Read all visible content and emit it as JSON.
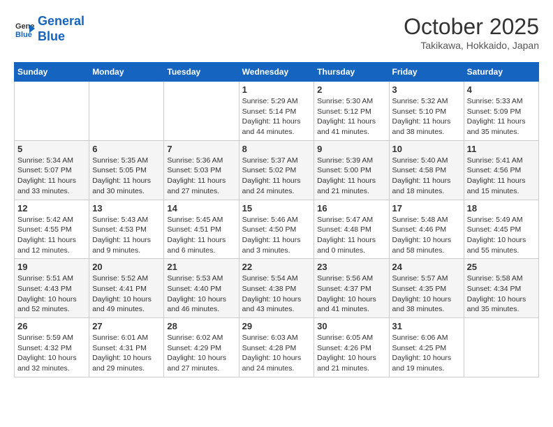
{
  "header": {
    "logo_line1": "General",
    "logo_line2": "Blue",
    "month": "October 2025",
    "location": "Takikawa, Hokkaido, Japan"
  },
  "weekdays": [
    "Sunday",
    "Monday",
    "Tuesday",
    "Wednesday",
    "Thursday",
    "Friday",
    "Saturday"
  ],
  "weeks": [
    [
      {
        "day": "",
        "info": ""
      },
      {
        "day": "",
        "info": ""
      },
      {
        "day": "",
        "info": ""
      },
      {
        "day": "1",
        "info": "Sunrise: 5:29 AM\nSunset: 5:14 PM\nDaylight: 11 hours and 44 minutes."
      },
      {
        "day": "2",
        "info": "Sunrise: 5:30 AM\nSunset: 5:12 PM\nDaylight: 11 hours and 41 minutes."
      },
      {
        "day": "3",
        "info": "Sunrise: 5:32 AM\nSunset: 5:10 PM\nDaylight: 11 hours and 38 minutes."
      },
      {
        "day": "4",
        "info": "Sunrise: 5:33 AM\nSunset: 5:09 PM\nDaylight: 11 hours and 35 minutes."
      }
    ],
    [
      {
        "day": "5",
        "info": "Sunrise: 5:34 AM\nSunset: 5:07 PM\nDaylight: 11 hours and 33 minutes."
      },
      {
        "day": "6",
        "info": "Sunrise: 5:35 AM\nSunset: 5:05 PM\nDaylight: 11 hours and 30 minutes."
      },
      {
        "day": "7",
        "info": "Sunrise: 5:36 AM\nSunset: 5:03 PM\nDaylight: 11 hours and 27 minutes."
      },
      {
        "day": "8",
        "info": "Sunrise: 5:37 AM\nSunset: 5:02 PM\nDaylight: 11 hours and 24 minutes."
      },
      {
        "day": "9",
        "info": "Sunrise: 5:39 AM\nSunset: 5:00 PM\nDaylight: 11 hours and 21 minutes."
      },
      {
        "day": "10",
        "info": "Sunrise: 5:40 AM\nSunset: 4:58 PM\nDaylight: 11 hours and 18 minutes."
      },
      {
        "day": "11",
        "info": "Sunrise: 5:41 AM\nSunset: 4:56 PM\nDaylight: 11 hours and 15 minutes."
      }
    ],
    [
      {
        "day": "12",
        "info": "Sunrise: 5:42 AM\nSunset: 4:55 PM\nDaylight: 11 hours and 12 minutes."
      },
      {
        "day": "13",
        "info": "Sunrise: 5:43 AM\nSunset: 4:53 PM\nDaylight: 11 hours and 9 minutes."
      },
      {
        "day": "14",
        "info": "Sunrise: 5:45 AM\nSunset: 4:51 PM\nDaylight: 11 hours and 6 minutes."
      },
      {
        "day": "15",
        "info": "Sunrise: 5:46 AM\nSunset: 4:50 PM\nDaylight: 11 hours and 3 minutes."
      },
      {
        "day": "16",
        "info": "Sunrise: 5:47 AM\nSunset: 4:48 PM\nDaylight: 11 hours and 0 minutes."
      },
      {
        "day": "17",
        "info": "Sunrise: 5:48 AM\nSunset: 4:46 PM\nDaylight: 10 hours and 58 minutes."
      },
      {
        "day": "18",
        "info": "Sunrise: 5:49 AM\nSunset: 4:45 PM\nDaylight: 10 hours and 55 minutes."
      }
    ],
    [
      {
        "day": "19",
        "info": "Sunrise: 5:51 AM\nSunset: 4:43 PM\nDaylight: 10 hours and 52 minutes."
      },
      {
        "day": "20",
        "info": "Sunrise: 5:52 AM\nSunset: 4:41 PM\nDaylight: 10 hours and 49 minutes."
      },
      {
        "day": "21",
        "info": "Sunrise: 5:53 AM\nSunset: 4:40 PM\nDaylight: 10 hours and 46 minutes."
      },
      {
        "day": "22",
        "info": "Sunrise: 5:54 AM\nSunset: 4:38 PM\nDaylight: 10 hours and 43 minutes."
      },
      {
        "day": "23",
        "info": "Sunrise: 5:56 AM\nSunset: 4:37 PM\nDaylight: 10 hours and 41 minutes."
      },
      {
        "day": "24",
        "info": "Sunrise: 5:57 AM\nSunset: 4:35 PM\nDaylight: 10 hours and 38 minutes."
      },
      {
        "day": "25",
        "info": "Sunrise: 5:58 AM\nSunset: 4:34 PM\nDaylight: 10 hours and 35 minutes."
      }
    ],
    [
      {
        "day": "26",
        "info": "Sunrise: 5:59 AM\nSunset: 4:32 PM\nDaylight: 10 hours and 32 minutes."
      },
      {
        "day": "27",
        "info": "Sunrise: 6:01 AM\nSunset: 4:31 PM\nDaylight: 10 hours and 29 minutes."
      },
      {
        "day": "28",
        "info": "Sunrise: 6:02 AM\nSunset: 4:29 PM\nDaylight: 10 hours and 27 minutes."
      },
      {
        "day": "29",
        "info": "Sunrise: 6:03 AM\nSunset: 4:28 PM\nDaylight: 10 hours and 24 minutes."
      },
      {
        "day": "30",
        "info": "Sunrise: 6:05 AM\nSunset: 4:26 PM\nDaylight: 10 hours and 21 minutes."
      },
      {
        "day": "31",
        "info": "Sunrise: 6:06 AM\nSunset: 4:25 PM\nDaylight: 10 hours and 19 minutes."
      },
      {
        "day": "",
        "info": ""
      }
    ]
  ]
}
